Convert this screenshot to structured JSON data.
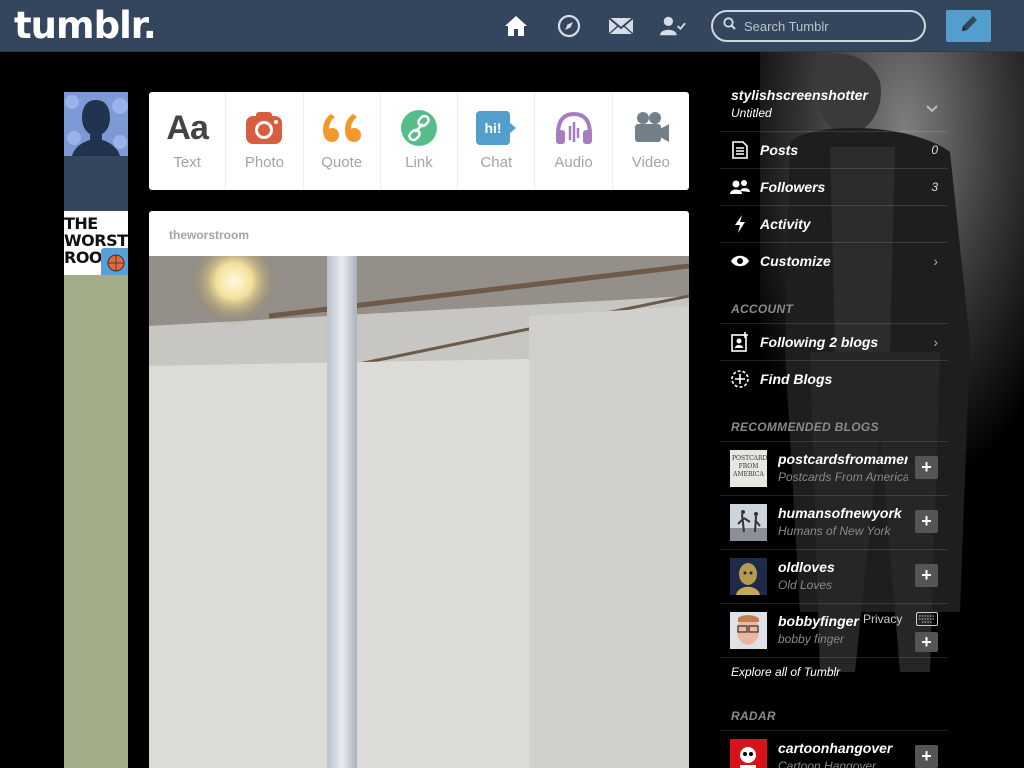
{
  "header": {
    "logo": "tumblr.",
    "search_placeholder": "Search Tumblr",
    "icons": [
      "home-icon",
      "explore-compass-icon",
      "mail-icon",
      "account-icon",
      "compose-pencil-icon"
    ]
  },
  "post_types": [
    {
      "label": "Text",
      "icon": "text-aa",
      "color": "#444444"
    },
    {
      "label": "Photo",
      "icon": "camera-icon",
      "color": "#d95e40"
    },
    {
      "label": "Quote",
      "icon": "quote-icon",
      "color": "#f2992e"
    },
    {
      "label": "Link",
      "icon": "link-icon",
      "color": "#56bc8a"
    },
    {
      "label": "Chat",
      "icon": "chat-icon",
      "color": "#529ecc"
    },
    {
      "label": "Audio",
      "icon": "headphones-icon",
      "color": "#a77dc2"
    },
    {
      "label": "Video",
      "icon": "video-camera-icon",
      "color": "#748089"
    }
  ],
  "text_icon_glyph": "Aa",
  "chat_icon_glyph": "hi!",
  "post": {
    "blog_name": "theworstroom",
    "avatar_text": "THE WORST ROOM"
  },
  "sidebar": {
    "blog_name": "stylishscreenshotter",
    "blog_subtitle": "Untitled",
    "menu": [
      {
        "label": "Posts",
        "count": "0",
        "icon": "posts-icon"
      },
      {
        "label": "Followers",
        "count": "3",
        "icon": "followers-icon"
      },
      {
        "label": "Activity",
        "count": "",
        "icon": "activity-bolt-icon"
      },
      {
        "label": "Customize",
        "count": "",
        "icon": "eye-icon"
      }
    ],
    "account_heading": "ACCOUNT",
    "account": [
      {
        "label": "Following 2 blogs",
        "icon": "following-icon"
      },
      {
        "label": "Find Blogs",
        "icon": "find-blogs-icon"
      }
    ],
    "recommended_heading": "RECOMMENDED BLOGS",
    "recommended": [
      {
        "name": "postcardsfromamerica",
        "title": "Postcards From America"
      },
      {
        "name": "humansofnewyork",
        "title": "Humans of New York"
      },
      {
        "name": "oldloves",
        "title": "Old Loves"
      },
      {
        "name": "bobbyfinger",
        "title": "bobby finger"
      }
    ],
    "postcard_avatar_text": "POSTCARDS FROM AMERICA",
    "privacy": "Privacy",
    "explore": "Explore all of Tumblr",
    "radar_heading": "RADAR",
    "radar": [
      {
        "name": "cartoonhangover",
        "title": "Cartoon Hangover"
      }
    ]
  },
  "colors": {
    "header_bg": "#34465d",
    "accent_blue": "#529ecc",
    "page_bg": "#000000"
  }
}
